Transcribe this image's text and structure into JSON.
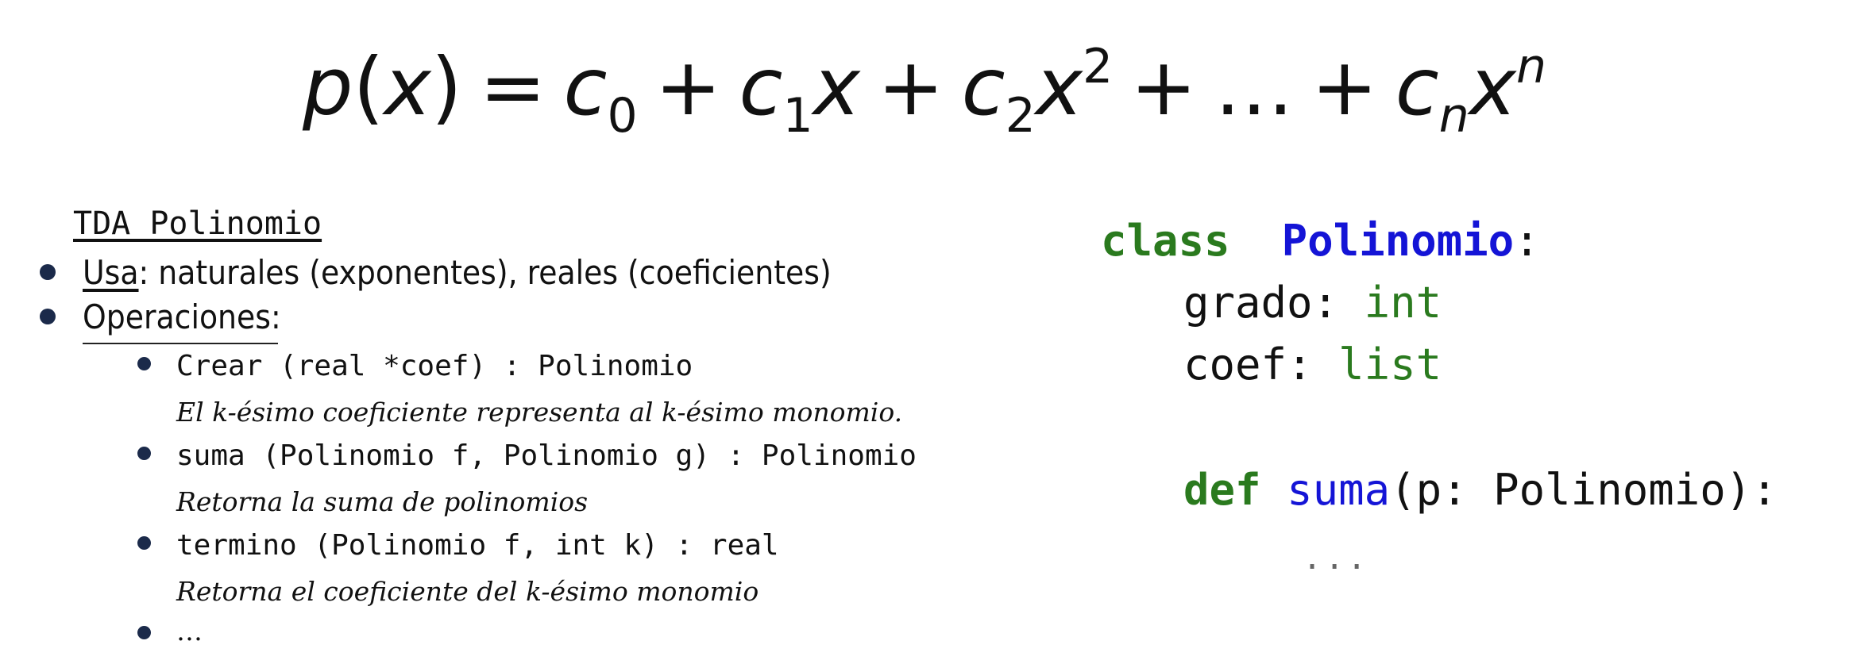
{
  "formula": {
    "lhs_fn": "p",
    "lhs_var": "x",
    "equals": "=",
    "c": "c",
    "x": "x",
    "sub0": "0",
    "sub1": "1",
    "sub2": "2",
    "subn": "n",
    "sup2": "2",
    "supn": "n",
    "plus": "+",
    "dots": "…"
  },
  "tda": {
    "title": "TDA Polinomio",
    "usa_label": "Usa",
    "usa_text": ": naturales (exponentes), reales (coeficientes)",
    "ops_label": "Operaciones",
    "ops_colon": ":",
    "operations": [
      {
        "signature": "Crear (real *coef) : Polinomio",
        "desc_pre": "El ",
        "desc_k1": "k",
        "desc_mid": "-ésimo coeficiente representa al ",
        "desc_k2": "k",
        "desc_post": "-ésimo monomio."
      },
      {
        "signature": "suma (Polinomio f, Polinomio g) : Polinomio",
        "desc": "Retorna la suma de polinomios"
      },
      {
        "signature": "termino (Polinomio f, int k) : real",
        "desc_pre": "Retorna el coeficiente del ",
        "desc_k": "k",
        "desc_post": "-ésimo monomio"
      }
    ],
    "more": "…"
  },
  "code": {
    "kw_class": "class",
    "class_name": "Polinomio",
    "colon": ":",
    "attr1_name": "grado: ",
    "attr1_type": "int",
    "attr2_name": "coef: ",
    "attr2_type": "list",
    "kw_def": "def",
    "method_name": "suma",
    "method_params": "(p: Polinomio):",
    "body": "..."
  }
}
